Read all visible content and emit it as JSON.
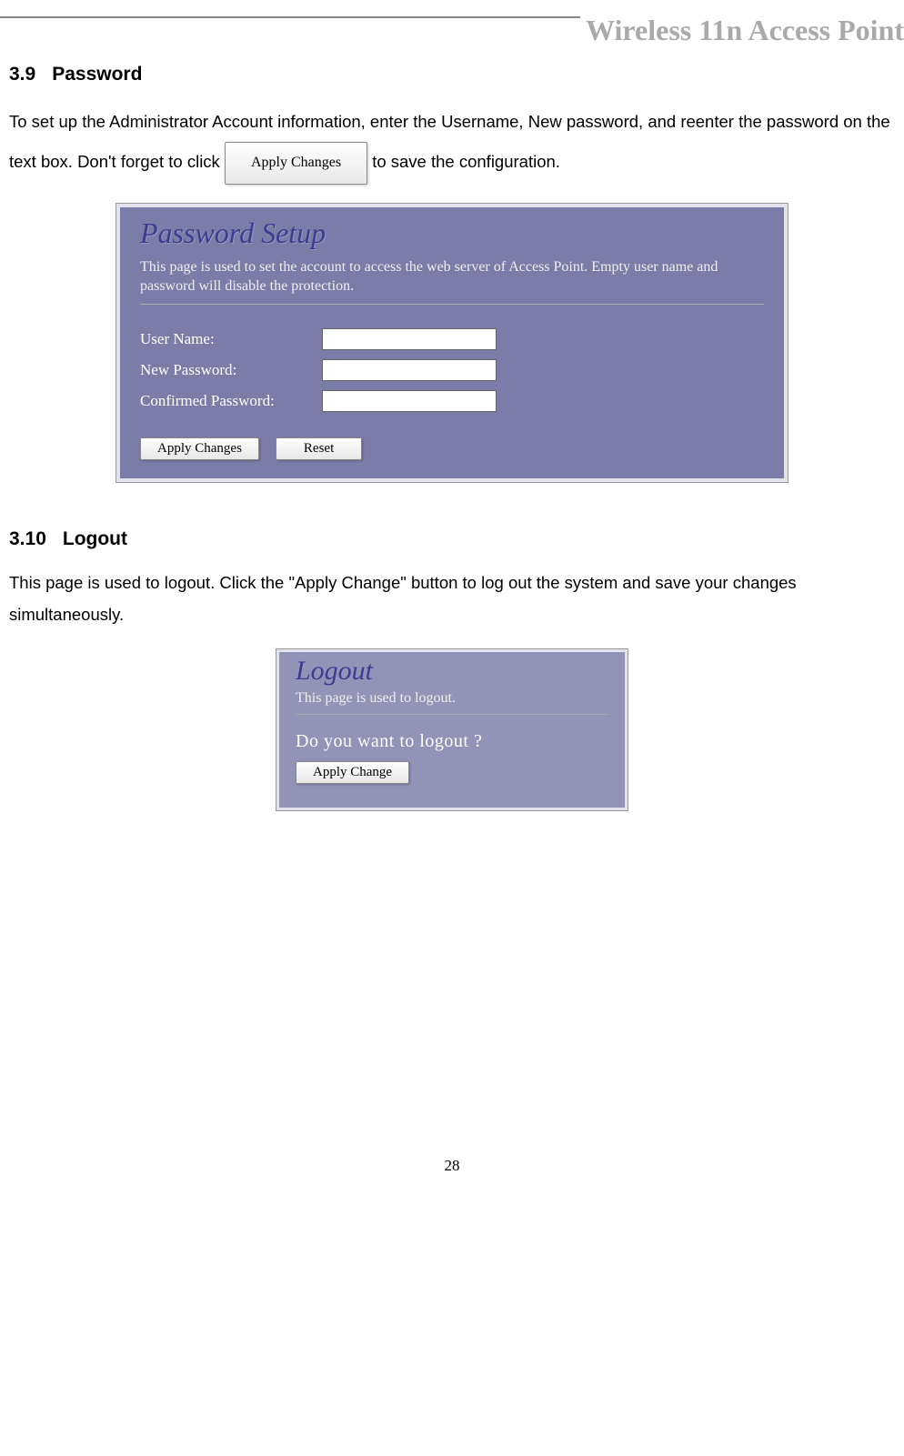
{
  "header": {
    "title": "Wireless 11n Access Point"
  },
  "sec1": {
    "num": "3.9",
    "title": "Password",
    "text_before_btn": "To set up the Administrator Account information, enter the Username, New password, and reenter the password on the text box. Don't forget to click ",
    "inline_btn": "Apply Changes",
    "text_after_btn": " to save the configuration."
  },
  "panel1": {
    "title": "Password Setup",
    "desc": "This page is used to set the account to access the web server of Access Point. Empty user name and password will disable the protection.",
    "rows": [
      {
        "label": "User Name:"
      },
      {
        "label": "New Password:"
      },
      {
        "label": "Confirmed Password:"
      }
    ],
    "buttons": {
      "apply": "Apply Changes",
      "reset": "Reset"
    }
  },
  "sec2": {
    "num": "3.10",
    "title": "Logout",
    "text": "This page is used to logout. Click the \"Apply Change\" button to log out the system and save your changes simultaneously."
  },
  "panel2": {
    "title": "Logout",
    "desc": "This page is used to logout.",
    "question": "Do you want to logout ?",
    "button": "Apply Change"
  },
  "page_num": "28"
}
